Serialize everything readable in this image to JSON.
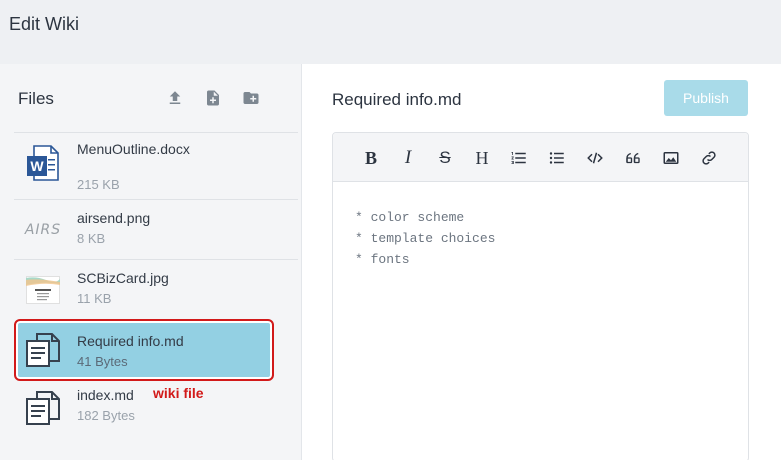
{
  "header": {
    "title": "Edit Wiki"
  },
  "sidebar": {
    "title": "Files",
    "tools": [
      {
        "name": "upload-icon"
      },
      {
        "name": "new-file-icon"
      },
      {
        "name": "new-folder-icon"
      }
    ],
    "files": [
      {
        "name": "MenuOutline.docx",
        "size": "215 KB",
        "icon": "word-doc-icon",
        "selected": false
      },
      {
        "name": "airsend.png",
        "size": "8 KB",
        "icon": "image-thumbnail",
        "thumb_text": "AIRS",
        "selected": false
      },
      {
        "name": "SCBizCard.jpg",
        "size": "11 KB",
        "icon": "image-thumbnail",
        "selected": false
      },
      {
        "name": "Required info.md",
        "size": "41 Bytes",
        "icon": "markdown-file-icon",
        "selected": true
      },
      {
        "name": "index.md",
        "size": "182 Bytes",
        "icon": "markdown-file-icon",
        "selected": false,
        "annotation": "wiki file"
      }
    ]
  },
  "editor": {
    "filename": "Required info.md",
    "publish_label": "Publish",
    "toolbar": [
      {
        "name": "bold-icon",
        "glyph": "B"
      },
      {
        "name": "italic-icon",
        "glyph": "I"
      },
      {
        "name": "strikethrough-icon",
        "glyph": "S"
      },
      {
        "name": "heading-icon",
        "glyph": "H"
      },
      {
        "name": "ordered-list-icon"
      },
      {
        "name": "unordered-list-icon"
      },
      {
        "name": "code-icon"
      },
      {
        "name": "quote-icon"
      },
      {
        "name": "image-icon"
      },
      {
        "name": "link-icon"
      }
    ],
    "lines": [
      "* color scheme",
      "* template choices",
      "* fonts"
    ]
  },
  "colors": {
    "selected_bg": "#93d0e3",
    "highlight_border": "#d21a1a",
    "publish_bg": "#a9dbe9",
    "annotation": "#d21a1a"
  }
}
